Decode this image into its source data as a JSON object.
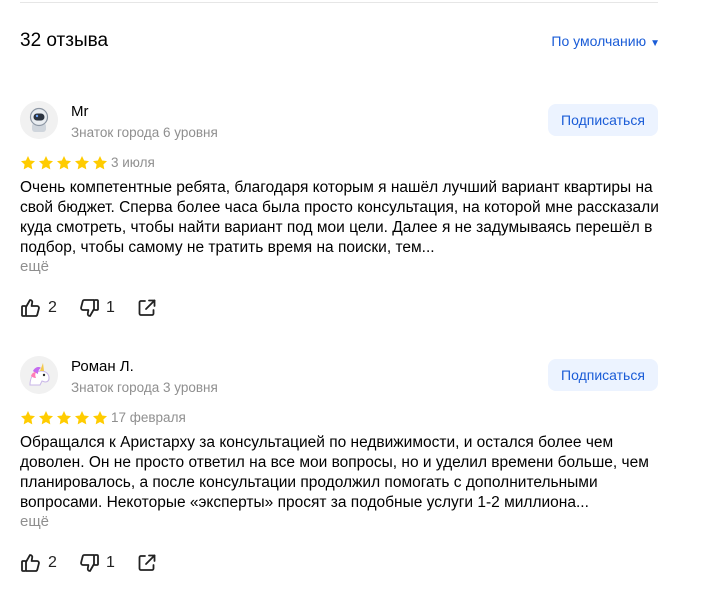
{
  "header": {
    "count": "32 отзыва",
    "sort_label": "По умолчанию"
  },
  "reviews": [
    {
      "author": "Mr",
      "level": "Знаток города 6 уровня",
      "subscribe_label": "Подписаться",
      "rating": 5,
      "date": "3 июля",
      "text": "Очень компетентные ребята, благодаря которым я нашёл лучший вариант квартиры на свой бюджет. Сперва более часа была просто консультация, на которой мне рассказали куда смотреть, чтобы найти вариант под мои цели. Далее я не задумываясь перешёл в подбор, чтобы самому не тратить время на поиски, тем...",
      "more_label": "ещё",
      "likes": "2",
      "dislikes": "1",
      "avatar_icon": "astronaut-icon"
    },
    {
      "author": "Роман Л.",
      "level": "Знаток города 3 уровня",
      "subscribe_label": "Подписаться",
      "rating": 5,
      "date": "17 февраля",
      "text": "Обращался к Аристарху за консультацией по недвижимости, и остался более чем доволен. Он не просто ответил на все мои вопросы, но и уделил времени больше, чем планировалось, а после консультации продолжил помогать с дополнительными вопросами. Некоторые «эксперты» просят за подобные услуги 1-2 миллиона...",
      "more_label": "ещё",
      "likes": "2",
      "dislikes": "1",
      "avatar_icon": "unicorn-icon"
    }
  ],
  "colors": {
    "accent": "#1a5cd7",
    "star": "#fc0",
    "muted": "#8f8f8f",
    "button_bg": "#ecf3ff"
  }
}
